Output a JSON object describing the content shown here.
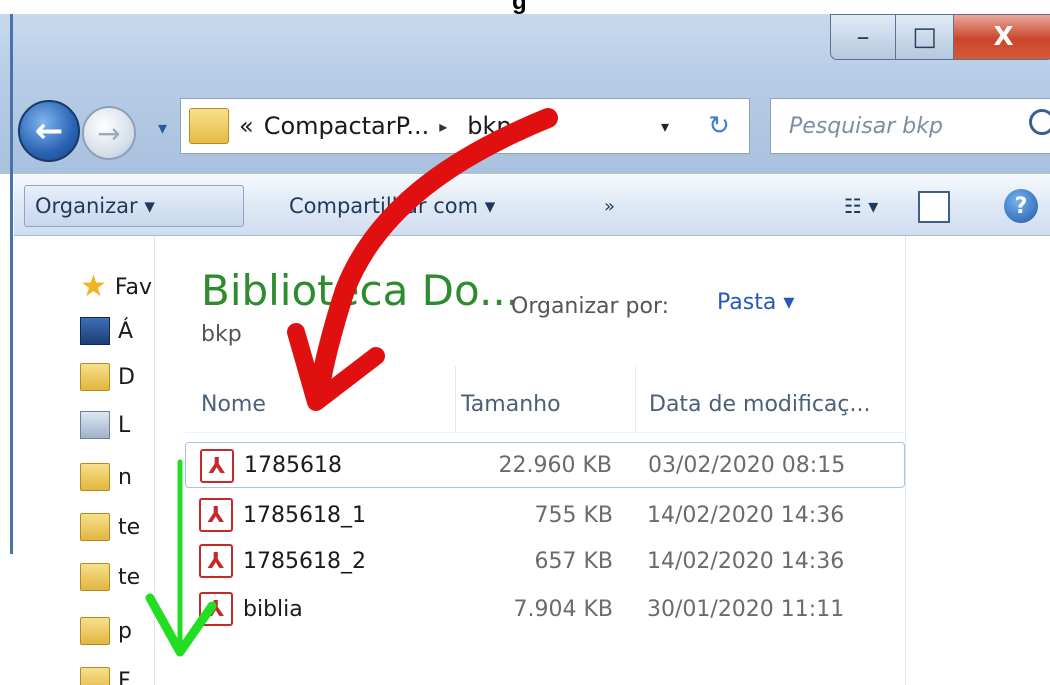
{
  "heading_fragment": "g",
  "caption": {
    "minimize": "–",
    "maximize": "□",
    "close": "X"
  },
  "nav": {
    "back_glyph": "←",
    "forward_glyph": "→",
    "address": {
      "prefix": "«",
      "segment1": "CompactarP...",
      "separator": "▸",
      "segment2": "bkp",
      "dropdown": "▾"
    },
    "refresh_glyph": "↻",
    "search_placeholder": "Pesquisar bkp"
  },
  "commandbar": {
    "organizar": "Organizar ▾",
    "compartilhar": "Compartilhar com ▾",
    "more": "»",
    "views": "☷ ▾",
    "help": "?"
  },
  "navpane": [
    {
      "label": "Fav",
      "icon": "star-icon"
    },
    {
      "label": "Á",
      "icon": "desktop-icon"
    },
    {
      "label": "D",
      "icon": "folder-icon"
    },
    {
      "label": "L",
      "icon": "library-icon"
    },
    {
      "label": "n",
      "icon": "folder-icon"
    },
    {
      "label": "te",
      "icon": "folder-icon"
    },
    {
      "label": "te",
      "icon": "folder-icon"
    },
    {
      "label": "p",
      "icon": "folder-icon"
    },
    {
      "label": "F",
      "icon": "folder-icon"
    }
  ],
  "library": {
    "title": "Biblioteca Do...",
    "subtitle": "bkp",
    "arrange_label": "Organizar por:",
    "arrange_value": "Pasta ▾"
  },
  "columns": {
    "name": "Nome",
    "size": "Tamanho",
    "date": "Data de modificaç..."
  },
  "files": [
    {
      "name": "1785618",
      "size": "22.960 KB",
      "date": "03/02/2020 08:15",
      "icon": "pdf-icon"
    },
    {
      "name": "1785618_1",
      "size": "755 KB",
      "date": "14/02/2020 14:36",
      "icon": "pdf-icon"
    },
    {
      "name": "1785618_2",
      "size": "657 KB",
      "date": "14/02/2020 14:36",
      "icon": "pdf-icon"
    },
    {
      "name": "biblia",
      "size": "7.904 KB",
      "date": "30/01/2020 11:11",
      "icon": "pdf-icon"
    }
  ],
  "colors": {
    "annotation_red": "#e01010",
    "annotation_green": "#22dd22",
    "library_title": "#2e8b2e",
    "link_blue": "#2459b8"
  }
}
